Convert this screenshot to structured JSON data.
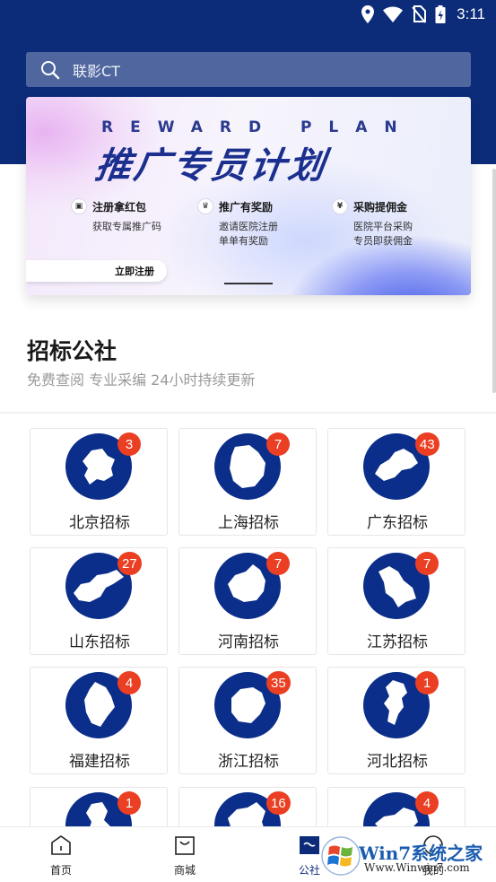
{
  "status_bar": {
    "time": "3:11",
    "icons": [
      "location-icon",
      "wifi-icon",
      "no-sim-icon",
      "battery-icon"
    ]
  },
  "search": {
    "placeholder": "联影CT"
  },
  "banner": {
    "subtitle_en": "REWARD PLAN",
    "title": "推广专员计划",
    "benefits": [
      {
        "icon": "gift-icon",
        "title": "注册拿红包",
        "lines": [
          "获取专属推广码"
        ]
      },
      {
        "icon": "trophy-icon",
        "title": "推广有奖励",
        "lines": [
          "邀请医院注册",
          "单单有奖励"
        ]
      },
      {
        "icon": "money-icon",
        "title": "采购提佣金",
        "lines": [
          "医院平台采购",
          "专员即获佣金"
        ]
      }
    ],
    "register_label": "立即注册"
  },
  "section": {
    "title": "招标公社",
    "subtitle": "免费查阅 专业采编 24小时持续更新"
  },
  "regions": [
    {
      "name": "北京招标",
      "count": "3"
    },
    {
      "name": "上海招标",
      "count": "7"
    },
    {
      "name": "广东招标",
      "count": "43"
    },
    {
      "name": "山东招标",
      "count": "27"
    },
    {
      "name": "河南招标",
      "count": "7"
    },
    {
      "name": "江苏招标",
      "count": "7"
    },
    {
      "name": "福建招标",
      "count": "4"
    },
    {
      "name": "浙江招标",
      "count": "35"
    },
    {
      "name": "河北招标",
      "count": "1"
    },
    {
      "name": "",
      "count": "1"
    },
    {
      "name": "",
      "count": "16"
    },
    {
      "name": "",
      "count": "4"
    }
  ],
  "nav": {
    "items": [
      {
        "label": "首页",
        "icon": "home-icon",
        "active": false
      },
      {
        "label": "商城",
        "icon": "shop-bag-icon",
        "active": false
      },
      {
        "label": "公社",
        "icon": "community-icon",
        "active": true
      },
      {
        "label": "我的",
        "icon": "profile-icon",
        "active": false
      }
    ]
  },
  "watermark": {
    "text": "Win7系统之家",
    "url": "Www.Winwin7.com"
  },
  "colors": {
    "header": "#0c2c7a",
    "badge": "#ea3f23",
    "map_circle": "#0b2e8a"
  }
}
